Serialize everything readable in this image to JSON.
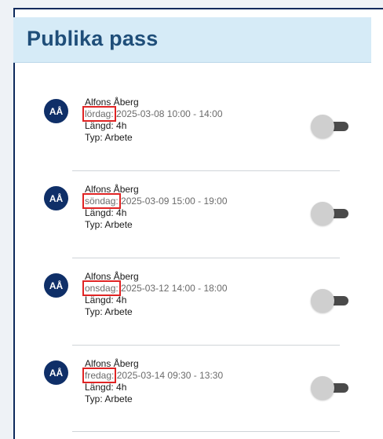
{
  "panel": {
    "title": "Publika pass"
  },
  "shifts": [
    {
      "initials": "AÅ",
      "name": "Alfons Åberg",
      "day": "lördag:",
      "datetime": "2025-03-08 10:00 - 14:00",
      "length": "Längd: 4h",
      "type": "Typ: Arbete"
    },
    {
      "initials": "AÅ",
      "name": "Alfons Åberg",
      "day": "söndag:",
      "datetime": "2025-03-09 15:00 - 19:00",
      "length": "Längd: 4h",
      "type": "Typ: Arbete"
    },
    {
      "initials": "AÅ",
      "name": "Alfons Åberg",
      "day": "onsdag:",
      "datetime": "2025-03-12 14:00 - 18:00",
      "length": "Längd: 4h",
      "type": "Typ: Arbete"
    },
    {
      "initials": "AÅ",
      "name": "Alfons Åberg",
      "day": "fredag:",
      "datetime": "2025-03-14 09:30 - 13:30",
      "length": "Längd: 4h",
      "type": "Typ: Arbete"
    }
  ]
}
